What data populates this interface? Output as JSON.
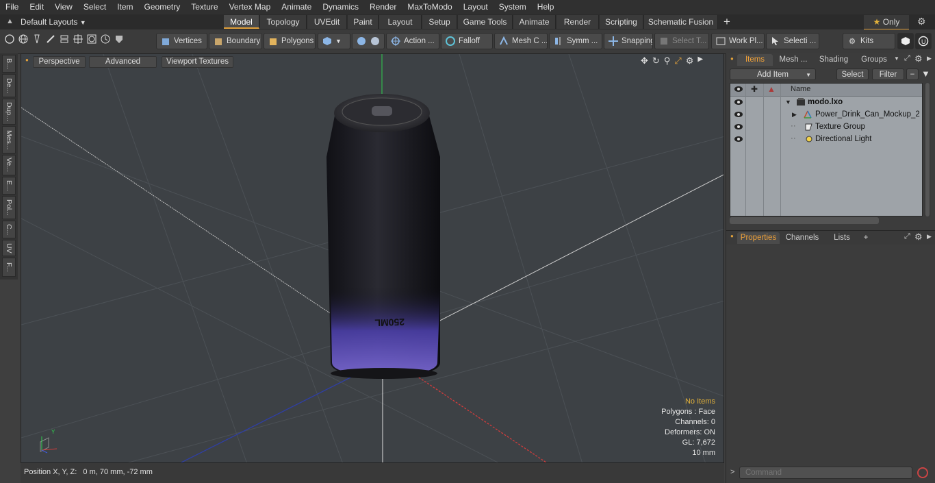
{
  "menu": [
    "File",
    "Edit",
    "View",
    "Select",
    "Item",
    "Geometry",
    "Texture",
    "Vertex Map",
    "Animate",
    "Dynamics",
    "Render",
    "MaxToModo",
    "Layout",
    "System",
    "Help"
  ],
  "layout_selector": "Default Layouts",
  "layout_tabs": [
    "Model",
    "Topology",
    "UVEdit",
    "Paint",
    "Layout",
    "Setup",
    "Game Tools",
    "Animate",
    "Render",
    "Scripting",
    "Schematic Fusion"
  ],
  "active_layout_tab": "Model",
  "only_label": "Only",
  "toolbar": {
    "vertices": "Vertices",
    "boundary": "Boundary",
    "polygons": "Polygons",
    "action": "Action ...",
    "falloff": "Falloff",
    "mesh": "Mesh C ...",
    "symmetry": "Symm ...",
    "snapping": "Snapping",
    "select_tool": "Select T...",
    "work_plane": "Work Pl...",
    "selection": "Selecti ...",
    "kits": "Kits"
  },
  "left_tabs": [
    "B...",
    "De...",
    "Dup...",
    "Mes...",
    "Ve...",
    "E...",
    "Pol...",
    "C...",
    "UV",
    "F..."
  ],
  "viewport": {
    "perspective": "Perspective",
    "advanced": "Advanced",
    "viewport_textures": "Viewport Textures",
    "can_label": "250ML",
    "info": {
      "no_items": "No Items",
      "polygons": "Polygons : Face",
      "channels": "Channels: 0",
      "deformers": "Deformers: ON",
      "gl": "GL: 7,672",
      "scale": "10 mm"
    }
  },
  "status": {
    "position": "Position X, Y, Z:   0 m, 70 mm, -72 mm"
  },
  "items_panel": {
    "tabs": [
      "Items",
      "Mesh ...",
      "Shading",
      "Groups"
    ],
    "add_item": "Add Item",
    "select": "Select",
    "filter": "Filter",
    "name_header": "Name",
    "rows": [
      {
        "label": "modo.lxo",
        "icon": "scene-icon"
      },
      {
        "label": "Power_Drink_Can_Mockup_2 ...",
        "icon": "mesh-locator-icon"
      },
      {
        "label": "Texture Group",
        "icon": "texture-group-icon"
      },
      {
        "label": "Directional Light",
        "icon": "light-icon"
      }
    ]
  },
  "properties_panel": {
    "tabs": [
      "Properties",
      "Channels",
      "Lists"
    ],
    "add": "+"
  },
  "command": {
    "placeholder": "Command"
  },
  "colors": {
    "accent": "#e3a23b",
    "viewport_bg": "#3d4145",
    "list_bg": "#9ea3a8"
  }
}
